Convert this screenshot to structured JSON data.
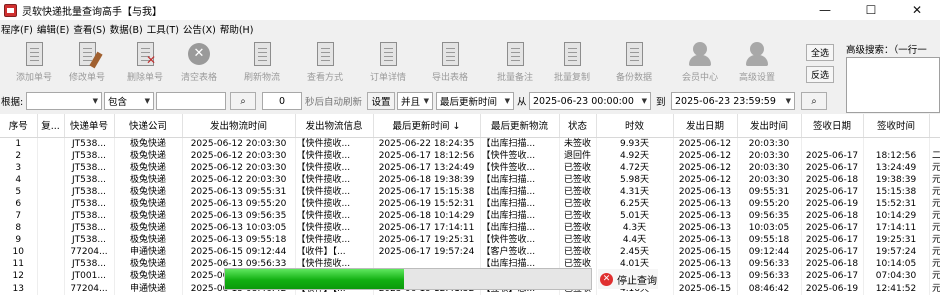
{
  "window": {
    "title": "灵软快递批量查询高手【与我】",
    "buttons": [
      "—",
      "☐",
      "✕"
    ]
  },
  "menu": [
    "程序(F)",
    "编辑(E)",
    "查看(S)",
    "数据(B)",
    "工具(T)",
    "公告(X)",
    "帮助(H)"
  ],
  "toolbar": [
    {
      "label": "添加单号",
      "icon": "add-doc-icon"
    },
    {
      "label": "修改单号",
      "icon": "edit-doc-icon"
    },
    {
      "label": "删除单号",
      "icon": "delete-doc-icon"
    },
    {
      "label": "清空表格",
      "icon": "clear-table-icon"
    },
    {
      "label": "刷新物流",
      "icon": "refresh-doc-icon"
    },
    {
      "label": "查看方式",
      "icon": "view-mode-icon"
    },
    {
      "label": "订单详情",
      "icon": "order-detail-icon"
    },
    {
      "label": "导出表格",
      "icon": "export-icon"
    },
    {
      "label": "批量备注",
      "icon": "batch-note-icon"
    },
    {
      "label": "批量复制",
      "icon": "batch-copy-icon"
    },
    {
      "label": "备份数据",
      "icon": "backup-icon"
    },
    {
      "label": "会员中心",
      "icon": "member-icon"
    },
    {
      "label": "高级设置",
      "icon": "settings-icon"
    }
  ],
  "side": {
    "select_all": "全选",
    "invert": "反选",
    "advanced_search": "高级搜索：（一行一"
  },
  "filter": {
    "root_label": "根据:",
    "contains": "包含",
    "search_glyph": "⌕",
    "seconds": "0",
    "auto_refresh": "秒后自动刷新",
    "settings": "设置",
    "and": "并且",
    "sort_field": "最后更新时间",
    "from": "从",
    "date_from": "2025-06-23 00:00:00",
    "to": "到",
    "date_to": "2025-06-23 23:59:59"
  },
  "table": {
    "columns": [
      "序号",
      "复...",
      "快递单号",
      "快递公司",
      "发出物流时间",
      "发出物流信息",
      "最后更新时间 ↓",
      "最后更新物流",
      "状态",
      "时效",
      "发出日期",
      "发出时间",
      "签收日期",
      "签收时间",
      ""
    ],
    "rows": [
      [
        "1",
        "",
        "JT538...",
        "极兔快递",
        "2025-06-12 20:03:30",
        "【快件揽收...",
        "2025-06-22 18:24:35",
        "【出库扫描...",
        "未签收",
        "9.93天",
        "2025-06-12",
        "20:03:30",
        "",
        "",
        ""
      ],
      [
        "2",
        "",
        "JT538...",
        "极兔快递",
        "2025-06-12 20:03:30",
        "【快件揽收...",
        "2025-06-17 18:12:56",
        "【快件签收...",
        "退回件",
        "4.92天",
        "2025-06-12",
        "20:03:30",
        "2025-06-17",
        "18:12:56",
        "二"
      ],
      [
        "3",
        "",
        "JT538...",
        "极兔快递",
        "2025-06-12 20:03:30",
        "【快件揽收...",
        "2025-06-17 13:24:49",
        "【快件签收...",
        "已签收",
        "4.72天",
        "2025-06-12",
        "20:03:30",
        "2025-06-17",
        "13:24:49",
        "元"
      ],
      [
        "4",
        "",
        "JT538...",
        "极兔快递",
        "2025-06-12 20:03:30",
        "【快件揽收...",
        "2025-06-18 19:38:39",
        "【出库扫描...",
        "已签收",
        "5.98天",
        "2025-06-12",
        "20:03:30",
        "2025-06-18",
        "19:38:39",
        "元"
      ],
      [
        "5",
        "",
        "JT538...",
        "极兔快递",
        "2025-06-13 09:55:31",
        "【快件揽收...",
        "2025-06-17 15:15:38",
        "【出库扫描...",
        "已签收",
        "4.31天",
        "2025-06-13",
        "09:55:31",
        "2025-06-17",
        "15:15:38",
        "元"
      ],
      [
        "6",
        "",
        "JT538...",
        "极兔快递",
        "2025-06-13 09:55:20",
        "【快件揽收...",
        "2025-06-19 15:52:31",
        "【出库扫描...",
        "已签收",
        "6.25天",
        "2025-06-13",
        "09:55:20",
        "2025-06-19",
        "15:52:31",
        "元"
      ],
      [
        "7",
        "",
        "JT538...",
        "极兔快递",
        "2025-06-13 09:56:35",
        "【快件揽收...",
        "2025-06-18 10:14:29",
        "【出库扫描...",
        "已签收",
        "5.01天",
        "2025-06-13",
        "09:56:35",
        "2025-06-18",
        "10:14:29",
        "元"
      ],
      [
        "8",
        "",
        "JT538...",
        "极兔快递",
        "2025-06-13 10:03:05",
        "【快件揽收...",
        "2025-06-17 17:14:11",
        "【出库扫描...",
        "已签收",
        "4.3天",
        "2025-06-13",
        "10:03:05",
        "2025-06-17",
        "17:14:11",
        "元"
      ],
      [
        "9",
        "",
        "JT538...",
        "极兔快递",
        "2025-06-13 09:55:18",
        "【快件揽收...",
        "2025-06-17 19:25:31",
        "【快件签收...",
        "已签收",
        "4.4天",
        "2025-06-13",
        "09:55:18",
        "2025-06-17",
        "19:25:31",
        "元"
      ],
      [
        "10",
        "",
        "77204...",
        "申通快递",
        "2025-06-15 09:12:44",
        "【收件】【...",
        "2025-06-17 19:57:24",
        "【客户签收...",
        "已签收",
        "2.45天",
        "2025-06-15",
        "09:12:44",
        "2025-06-17",
        "19:57:24",
        "元"
      ],
      [
        "11",
        "",
        "JT538...",
        "极兔快递",
        "2025-06-13 09:56:33",
        "【快件揽收...",
        "",
        "【出库扫描...",
        "已签收",
        "4.01天",
        "2025-06-13",
        "09:56:33",
        "2025-06-18",
        "10:14:05",
        "元"
      ],
      [
        "12",
        "",
        "JT001...",
        "极兔快递",
        "2025-06-13 09:56:33",
        "【快件揽收...",
        "",
        "【出库扫描...",
        "已签收",
        "3.95天",
        "2025-06-13",
        "09:56:33",
        "2025-06-17",
        "07:04:30",
        "元"
      ],
      [
        "13",
        "",
        "77204...",
        "申通快递",
        "2025-06-15 08:46:42",
        "【收件】【...",
        "2025-06-19 12:41:52",
        "【签收】您...",
        "已签收",
        "4.16天",
        "2025-06-15",
        "08:46:42",
        "2025-06-19",
        "12:41:52",
        "元"
      ]
    ]
  },
  "progress": {
    "value": 0.49
  },
  "stop_button": "停止查询"
}
